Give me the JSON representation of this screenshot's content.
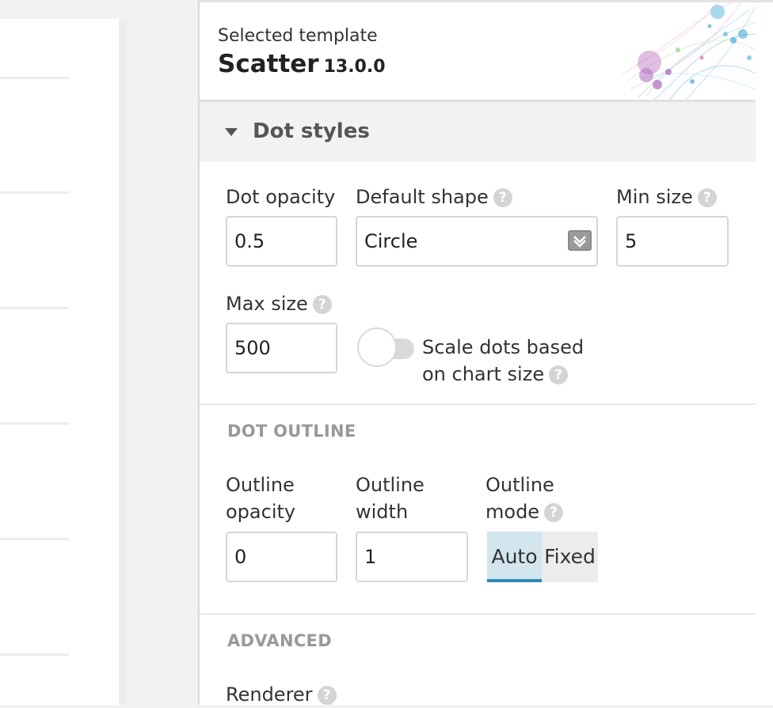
{
  "header": {
    "subtitle": "Selected template",
    "template_name": "Scatter",
    "version": "13.0.0"
  },
  "section": {
    "title": "Dot styles",
    "collapse_icon": "caret-down-icon"
  },
  "dot_styles": {
    "dot_opacity": {
      "label": "Dot opacity",
      "value": "0.5"
    },
    "default_shape": {
      "label": "Default shape",
      "value": "Circle",
      "help_icon": "question-icon"
    },
    "min_size": {
      "label": "Min size",
      "value": "5",
      "help_icon": "question-icon"
    },
    "max_size": {
      "label": "Max size",
      "value": "500",
      "help_icon": "question-icon"
    },
    "scale_toggle": {
      "label_line1": "Scale dots based",
      "label_line2": "on chart size",
      "state": "off"
    }
  },
  "dot_outline": {
    "heading": "DOT OUTLINE",
    "outline_opacity": {
      "label_line1": "Outline",
      "label_line2": "opacity",
      "value": "0"
    },
    "outline_width": {
      "label_line1": "Outline",
      "label_line2": "width",
      "value": "1"
    },
    "outline_mode": {
      "label_line1": "Outline",
      "label_line2": "mode",
      "options": [
        "Auto",
        "Fixed"
      ],
      "selected": "Auto"
    }
  },
  "advanced": {
    "heading": "ADVANCED",
    "renderer_label": "Renderer"
  },
  "help_glyph": "?",
  "colors": {
    "accent": "#2f87b8",
    "selected_segment_bg": "#d3e6ee",
    "section_header_bg": "#f2f2f2"
  }
}
